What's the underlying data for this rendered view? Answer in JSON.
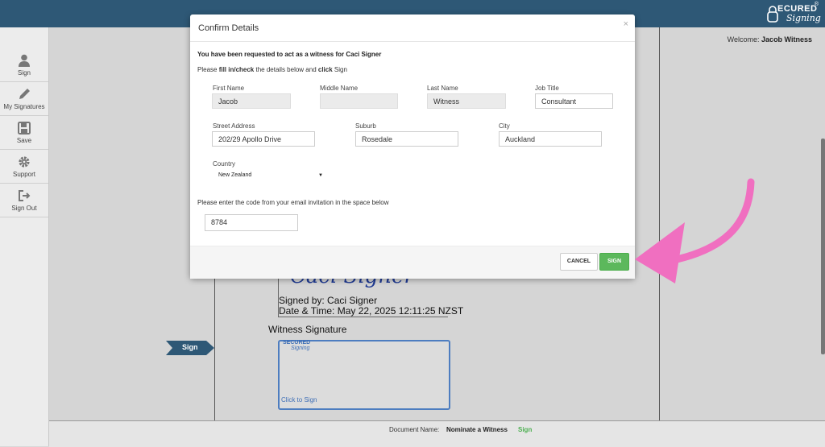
{
  "app": {
    "logo_word": "ECURED",
    "logo_script": "Signing",
    "logo_reg": "®"
  },
  "header": {
    "welcome_label": "Welcome:",
    "welcome_user": "Jacob Witness"
  },
  "sidebar": {
    "items": [
      {
        "label": "Sign",
        "icon": "user-icon"
      },
      {
        "label": "My Signatures",
        "icon": "pencil-icon"
      },
      {
        "label": "Save",
        "icon": "save-icon"
      },
      {
        "label": "Support",
        "icon": "gear-icon"
      },
      {
        "label": "Sign Out",
        "icon": "sign-out-icon"
      }
    ]
  },
  "document": {
    "signer_scribble": "Caci Signer",
    "signed_by": "Signed by: Caci Signer",
    "date_time": "Date & Time: May 22, 2025 12:11:25 NZST",
    "witness_title": "Witness Signature",
    "witness_logo_word": "SECURED",
    "witness_logo_script": "Signing",
    "click_to_sign": "Click to Sign",
    "sign_tag": "Sign"
  },
  "footer": {
    "doc_label": "Document Name:",
    "doc_name": "Nominate a Witness",
    "doc_action": "Sign"
  },
  "modal": {
    "title": "Confirm Details",
    "close": "×",
    "intro": "You have been requested to act as a witness for Caci Signer",
    "instr_prefix": "Please ",
    "instr_b1": "fill in/check",
    "instr_mid": " the details below and ",
    "instr_b2": "click",
    "instr_suffix": " Sign",
    "fields": {
      "first_name": {
        "label": "First Name",
        "value": "Jacob"
      },
      "middle_name": {
        "label": "Middle Name",
        "value": ""
      },
      "last_name": {
        "label": "Last Name",
        "value": "Witness"
      },
      "job_title": {
        "label": "Job Title",
        "value": "Consultant"
      },
      "street": {
        "label": "Street Address",
        "value": "202/29 Apollo Drive"
      },
      "suburb": {
        "label": "Suburb",
        "value": "Rosedale"
      },
      "city": {
        "label": "City",
        "value": "Auckland"
      },
      "country": {
        "label": "Country",
        "value": "New Zealand"
      }
    },
    "code_label": "Please enter the code from your email invitation in the space below",
    "code_value": "8784",
    "cancel_label": "CANCEL",
    "sign_label": "SIGN"
  },
  "colors": {
    "topbar": "#2e5876",
    "sign_button": "#5cb85c",
    "annotation_arrow": "#f06fc0",
    "witness_border": "#4d7dc0"
  }
}
